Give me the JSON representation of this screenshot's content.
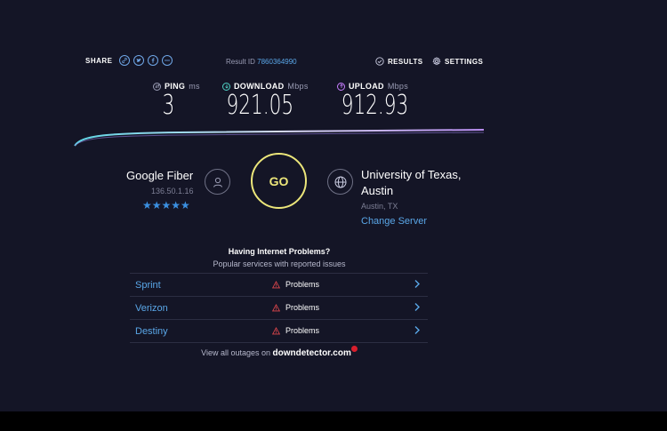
{
  "header": {
    "share_label": "SHARE",
    "share_icons": [
      "link-icon",
      "twitter-icon",
      "facebook-icon",
      "more-icon"
    ],
    "result_id_label": "Result ID",
    "result_id_value": "7860364990",
    "results_label": "RESULTS",
    "settings_label": "SETTINGS"
  },
  "metrics": {
    "ping": {
      "label": "PING",
      "unit": "ms",
      "value": "3"
    },
    "download": {
      "label": "DOWNLOAD",
      "unit": "Mbps",
      "value": "921.05"
    },
    "upload": {
      "label": "UPLOAD",
      "unit": "Mbps",
      "value": "912.93"
    }
  },
  "isp": {
    "name": "Google Fiber",
    "ip": "136.50.1.16",
    "stars": "★★★★★",
    "rating": 5
  },
  "go_button": {
    "label": "GO"
  },
  "server": {
    "name": "University of Texas, Austin",
    "location": "Austin, TX",
    "change_label": "Change Server"
  },
  "problems": {
    "title": "Having Internet Problems?",
    "subtitle": "Popular services with reported issues",
    "items": [
      {
        "name": "Sprint",
        "status": "Problems"
      },
      {
        "name": "Verizon",
        "status": "Problems"
      },
      {
        "name": "Destiny",
        "status": "Problems"
      }
    ],
    "outages_prefix": "View all outages on",
    "outages_site": "downdetector.com"
  },
  "colors": {
    "background": "#141526",
    "accent_blue": "#5aa7e8",
    "go_yellow": "#ece67a",
    "warning_red": "#d81e2c"
  }
}
